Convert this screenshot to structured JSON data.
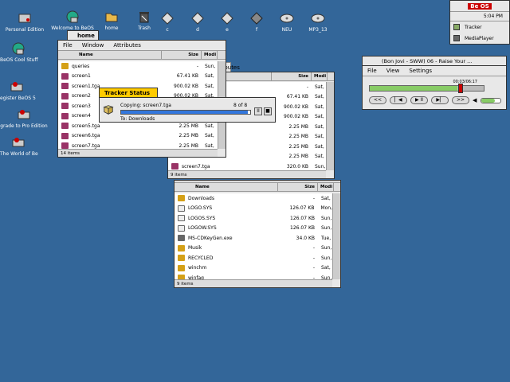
{
  "desktop_icons": [
    {
      "label": "Personal Edition",
      "icon": "disk-icon"
    },
    {
      "label": "Welcome to BeOS",
      "icon": "globe-icon"
    },
    {
      "label": "home",
      "icon": "folder-icon"
    },
    {
      "label": "Trash",
      "icon": "trash-icon"
    },
    {
      "label": "c",
      "icon": "drive-icon"
    },
    {
      "label": "d",
      "icon": "drive-icon"
    },
    {
      "label": "e",
      "icon": "drive-icon"
    },
    {
      "label": "f",
      "icon": "drive-icon"
    },
    {
      "label": "NEU",
      "icon": "cd-icon"
    },
    {
      "label": "MP3_13",
      "icon": "cd-icon"
    },
    {
      "label": "BeOS Cool Stuff",
      "icon": "globe-icon"
    },
    {
      "label": "egister BeOS 5",
      "icon": "register-icon"
    },
    {
      "label": "grade to Pro Edition",
      "icon": "register-icon"
    },
    {
      "label": "The World of Be",
      "icon": "register-icon"
    }
  ],
  "deskbar": {
    "logo": "Be OS",
    "clock": "5:04 PM",
    "items": [
      "Tracker",
      "MediaPlayer"
    ]
  },
  "home_window": {
    "title": "home",
    "menu": [
      "File",
      "Window",
      "Attributes"
    ],
    "columns": [
      "Name",
      "Size",
      "Modi"
    ],
    "rows": [
      {
        "name": "queries",
        "size": "-",
        "mod": "Sun,",
        "icon": "folder"
      },
      {
        "name": "screen1",
        "size": "67.41 KB",
        "mod": "Sat,",
        "icon": "tga"
      },
      {
        "name": "screen1.tga",
        "size": "900.02 KB",
        "mod": "Sat,",
        "icon": "tga"
      },
      {
        "name": "screen2",
        "size": "900.02 KB",
        "mod": "Sat,",
        "icon": "tga"
      },
      {
        "name": "screen3",
        "size": "900.02 KB",
        "mod": "Sat,",
        "icon": "tga"
      },
      {
        "name": "screen4",
        "size": "2.25 MB",
        "mod": "Sat,",
        "icon": "tga"
      },
      {
        "name": "screen5.tga",
        "size": "2.25 MB",
        "mod": "Sat,",
        "icon": "tga"
      },
      {
        "name": "screen6.tga",
        "size": "2.25 MB",
        "mod": "Sat,",
        "icon": "tga"
      },
      {
        "name": "screen7.tga",
        "size": "2.25 MB",
        "mod": "Sat,",
        "icon": "tga"
      }
    ],
    "status": "14 items"
  },
  "tracker_status": {
    "title": "Tracker Status",
    "copying": "Copying: screen7.tga",
    "count": "8 of 8",
    "destination": "To: Downloads",
    "progress": 0.98
  },
  "window2": {
    "title": "ttributes",
    "columns": [
      "Size",
      "Modi"
    ],
    "rows": [
      {
        "name": "",
        "size": "-",
        "mod": "Sat,"
      },
      {
        "name": "",
        "size": "67.41 KB",
        "mod": "Sat,"
      },
      {
        "name": "",
        "size": "900.02 KB",
        "mod": "Sat,"
      },
      {
        "name": "",
        "size": "900.02 KB",
        "mod": "Sat,"
      },
      {
        "name": "",
        "size": "2.25 MB",
        "mod": "Sat,"
      },
      {
        "name": "",
        "size": "2.25 MB",
        "mod": "Sat,"
      },
      {
        "name": "",
        "size": "2.25 MB",
        "mod": "Sat,"
      },
      {
        "name": "",
        "size": "2.25 MB",
        "mod": "Sat,"
      },
      {
        "name": "screen7.tga",
        "size": "320.0 KB",
        "mod": "Sun,"
      }
    ],
    "status": "9 items"
  },
  "downloads_window": {
    "columns": [
      "Name",
      "Size",
      "Modi"
    ],
    "rows": [
      {
        "name": "Downloads",
        "size": "-",
        "mod": "Sat,",
        "icon": "folder"
      },
      {
        "name": "LOGO.SYS",
        "size": "126.07 KB",
        "mod": "Mon,",
        "icon": "sys"
      },
      {
        "name": "LOGOS.SYS",
        "size": "126.07 KB",
        "mod": "Sun,",
        "icon": "sys"
      },
      {
        "name": "LOGOW.SYS",
        "size": "126.07 KB",
        "mod": "Sun,",
        "icon": "sys"
      },
      {
        "name": "MS-CDKeyGen.exe",
        "size": "34.0 KB",
        "mod": "Tue,",
        "icon": "zipico"
      },
      {
        "name": "Musik",
        "size": "-",
        "mod": "Sun,",
        "icon": "folder"
      },
      {
        "name": "RECYCLED",
        "size": "-",
        "mod": "Sun,",
        "icon": "folder"
      },
      {
        "name": "winchm",
        "size": "-",
        "mod": "Sat,",
        "icon": "folder"
      },
      {
        "name": "winfaq",
        "size": "-",
        "mod": "Sun,",
        "icon": "folder"
      }
    ],
    "status": "9 items"
  },
  "media_player": {
    "title": "(Bon Jovi - SWW) 06 - Raise Your ...",
    "menu": [
      "File",
      "View",
      "Settings"
    ],
    "time": "00:03/06:17",
    "progress": 0.77,
    "volume": 0.7,
    "buttons": [
      "<<",
      "▏◀",
      "▶ II",
      "▶▏",
      ">>"
    ]
  },
  "colors": {
    "desktop": "#336699",
    "tab": "#ffcb00",
    "progress": "#3377dd"
  }
}
